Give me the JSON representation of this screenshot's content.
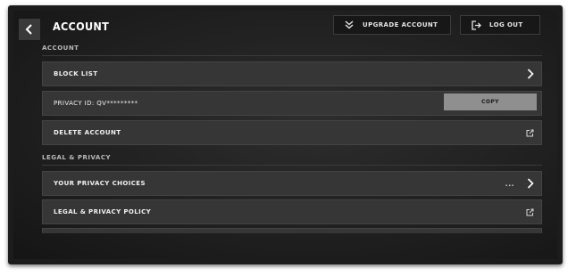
{
  "header": {
    "back_icon": "chevron-left-icon",
    "title": "ACCOUNT",
    "upgrade": {
      "icon": "double-chevron-down-icon",
      "label": "UPGRADE ACCOUNT"
    },
    "logout": {
      "icon": "logout-icon",
      "label": "LOG OUT"
    }
  },
  "account_section": {
    "heading": "ACCOUNT",
    "block_list": {
      "label": "BLOCK LIST",
      "icon": "chevron-right-icon"
    },
    "privacy_id": {
      "label": "PRIVACY ID: QV*********",
      "button": "COPY"
    },
    "delete_account": {
      "label": "DELETE ACCOUNT",
      "icon": "external-link-icon"
    }
  },
  "legal_section": {
    "heading": "LEGAL & PRIVACY",
    "privacy_choices": {
      "label": "YOUR PRIVACY CHOICES",
      "ellipsis": "...",
      "icon": "chevron-right-icon"
    },
    "privacy_policy": {
      "label": "LEGAL & PRIVACY POLICY",
      "icon": "external-link-icon"
    }
  }
}
